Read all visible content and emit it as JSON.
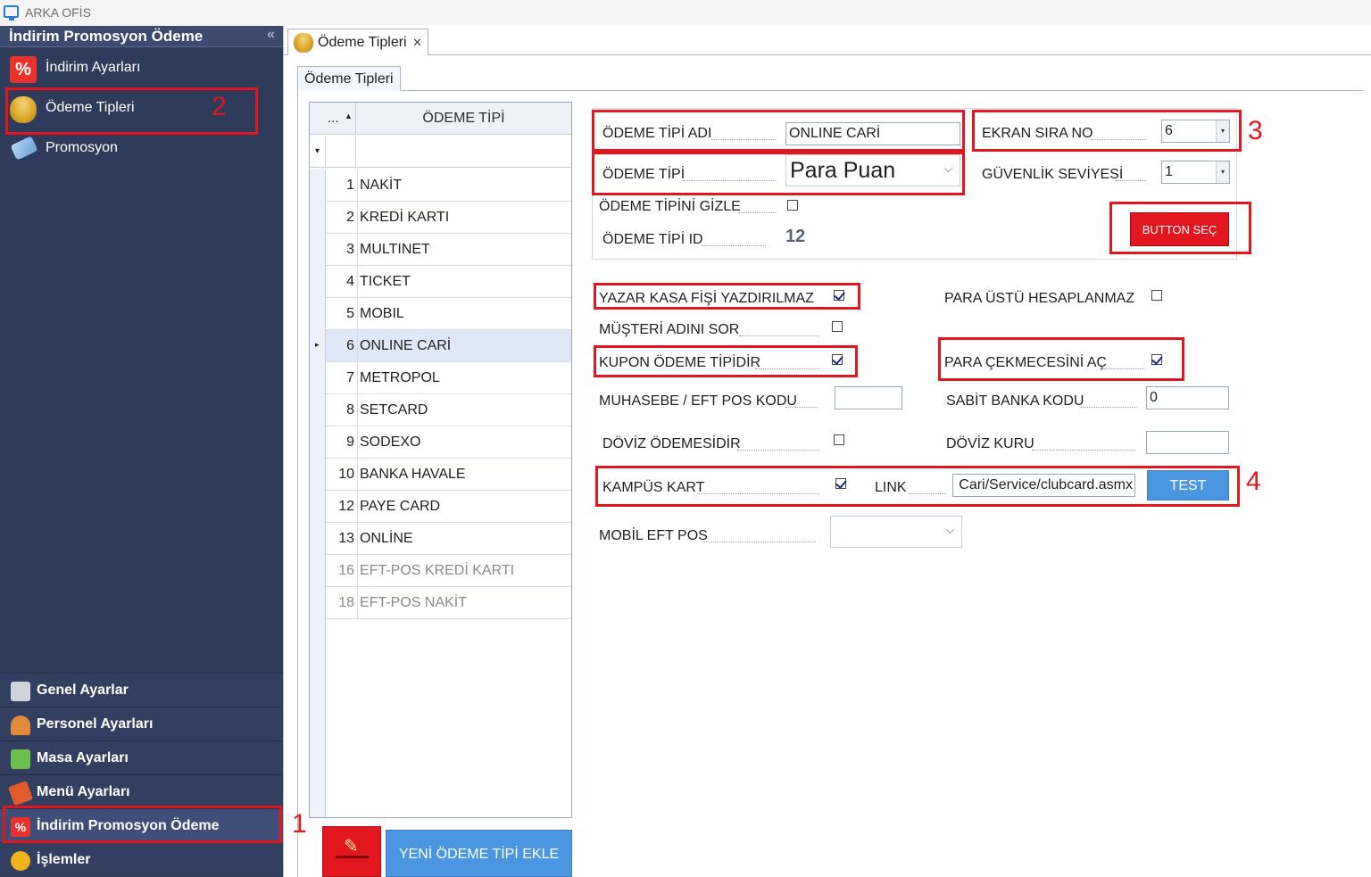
{
  "window": {
    "title": "ARKA OFİS"
  },
  "sidebar": {
    "header": "İndirim Promosyon Ödeme",
    "collapse_glyph": "«",
    "items": [
      {
        "label": "İndirim Ayarları",
        "icon": "percent-icon"
      },
      {
        "label": "Ödeme Tipleri",
        "icon": "coins-icon"
      },
      {
        "label": "Promosyon",
        "icon": "tag-icon"
      }
    ],
    "bottom_groups": [
      {
        "label": "Genel Ayarlar",
        "icon": "tools-icon",
        "color": "#d8d8d8"
      },
      {
        "label": "Personel Ayarları",
        "icon": "person-icon",
        "color": "#e28a3c"
      },
      {
        "label": "Masa Ayarları",
        "icon": "table-icon",
        "color": "#6bbf4a"
      },
      {
        "label": "Menü Ayarları",
        "icon": "menu-icon",
        "color": "#e25b2a"
      },
      {
        "label": "İndirim Promosyon Ödeme",
        "icon": "percent-icon",
        "color": "#e8322b"
      },
      {
        "label": "İşlemler",
        "icon": "gear-icon",
        "color": "#f2b21c"
      }
    ]
  },
  "annotations": {
    "n1": "1",
    "n2": "2",
    "n3": "3",
    "n4": "4"
  },
  "doc_tab": {
    "label": "Ödeme Tipleri",
    "close": "✕"
  },
  "inner_tab": {
    "label": "Ödeme Tipleri"
  },
  "grid": {
    "col1_header": "...",
    "col1_sort": "▲",
    "col2_header": "ÖDEME TİPİ",
    "filter_glyph": "▾",
    "row_indicator": "▸",
    "rows": [
      {
        "id": "1",
        "name": "NAKİT"
      },
      {
        "id": "2",
        "name": "KREDİ KARTI"
      },
      {
        "id": "3",
        "name": "MULTINET"
      },
      {
        "id": "4",
        "name": "TICKET"
      },
      {
        "id": "5",
        "name": "MOBIL"
      },
      {
        "id": "6",
        "name": "ONLINE CARİ"
      },
      {
        "id": "7",
        "name": "METROPOL"
      },
      {
        "id": "8",
        "name": "SETCARD"
      },
      {
        "id": "9",
        "name": "SODEXO"
      },
      {
        "id": "10",
        "name": "BANKA HAVALE"
      },
      {
        "id": "12",
        "name": "PAYE CARD"
      },
      {
        "id": "13",
        "name": "ONLİNE"
      },
      {
        "id": "16",
        "name": "EFT-POS KREDİ KARTI"
      },
      {
        "id": "18",
        "name": "EFT-POS NAKİT"
      }
    ],
    "selected_row": "6"
  },
  "buttons": {
    "edit_icon": "✎",
    "add_label": "YENİ ÖDEME TİPİ EKLE",
    "button_sec": "BUTTON SEÇ",
    "test": "TEST"
  },
  "form": {
    "odeme_tipi_adi_label": "ÖDEME TİPİ ADI",
    "odeme_tipi_adi_value": "ONLINE CARİ",
    "odeme_tipi_label": "ÖDEME TİPİ",
    "odeme_tipi_value": "Para Puan",
    "gizle_label": "ÖDEME TİPİNİ GİZLE",
    "gizle_checked": false,
    "id_label": "ÖDEME TİPİ ID",
    "id_value": "12",
    "ekran_sira_label": "EKRAN SIRA NO",
    "ekran_sira_value": "6",
    "guvenlik_label": "GÜVENLİK SEVİYESİ",
    "guvenlik_value": "1",
    "yazar_kasa_label": "YAZAR KASA FİŞİ YAZDIRILMAZ",
    "yazar_kasa_checked": true,
    "para_ustu_label": "PARA ÜSTÜ HESAPLANMAZ",
    "para_ustu_checked": false,
    "musteri_adi_label": "MÜŞTERİ ADINI SOR",
    "musteri_adi_checked": false,
    "kupon_label": "KUPON ÖDEME TİPİDİR",
    "kupon_checked": true,
    "cekmece_label": "PARA ÇEKMECESİNİ AÇ",
    "cekmece_checked": true,
    "muhasebe_label": "MUHASEBE / EFT POS KODU",
    "muhasebe_value": "",
    "sabit_banka_label": "SABİT BANKA KODU",
    "sabit_banka_value": "0",
    "doviz_odeme_label": "DÖVİZ ÖDEMESİDİR",
    "doviz_odeme_checked": false,
    "doviz_kuru_label": "DÖVİZ KURU",
    "doviz_kuru_value": "",
    "kampus_label": "KAMPÜS KART",
    "kampus_checked": true,
    "link_label": "LINK",
    "link_value": "Cari/Service/clubcard.asmx",
    "mobil_eft_label": "MOBİL EFT POS",
    "mobil_eft_value": ""
  },
  "colors": {
    "accent_red": "#e1161f",
    "accent_blue": "#4a96e0",
    "sidebar_bg": "#2e3b5a"
  }
}
